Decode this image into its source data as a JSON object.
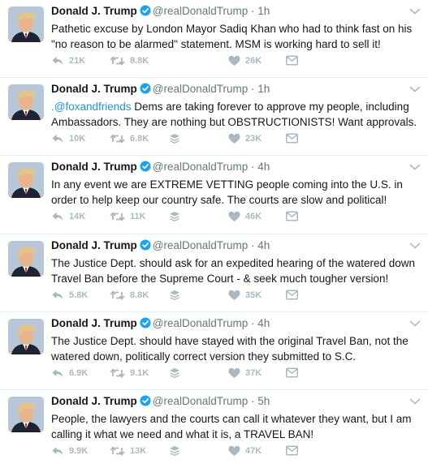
{
  "tweets": [
    {
      "name": "Donald J. Trump",
      "handle": "@realDonaldTrump",
      "dot": "·",
      "time": "1h",
      "mention": "",
      "text": "Pathetic excuse by London Mayor Sadiq Khan who had to think fast on his \"no reason to be alarmed\" statement. MSM is working hard to sell it!",
      "replies": "21K",
      "retweets": "8.8K",
      "likes": "26K",
      "icon_after_retweet": "heart-icon"
    },
    {
      "name": "Donald J. Trump",
      "handle": "@realDonaldTrump",
      "dot": "·",
      "time": "1h",
      "mention": ".@foxandfriends",
      "text": "  Dems are taking forever to approve my people, including Ambassadors. They are nothing but OBSTRUCTIONISTS! Want approvals.",
      "replies": "10K",
      "retweets": "6.8K",
      "likes": "23K",
      "icon_after_retweet": "buffer-icon"
    },
    {
      "name": "Donald J. Trump",
      "handle": "@realDonaldTrump",
      "dot": "·",
      "time": "4h",
      "mention": "",
      "text": "In any event we are EXTREME VETTING people coming into the U.S. in order to help keep our country safe. The courts are slow and political!",
      "replies": "14K",
      "retweets": "11K",
      "likes": "46K",
      "icon_after_retweet": "buffer-icon"
    },
    {
      "name": "Donald J. Trump",
      "handle": "@realDonaldTrump",
      "dot": "·",
      "time": "4h",
      "mention": "",
      "text": "The Justice Dept. should ask for an expedited hearing of the watered down Travel Ban before the Supreme Court - & seek much tougher version!",
      "replies": "5.8K",
      "retweets": "8.8K",
      "likes": "35K",
      "icon_after_retweet": "buffer-icon"
    },
    {
      "name": "Donald J. Trump",
      "handle": "@realDonaldTrump",
      "dot": "·",
      "time": "4h",
      "mention": "",
      "text": "The Justice Dept. should have stayed with the original Travel Ban, not the watered down, politically correct version they submitted to S.C.",
      "replies": "6.9K",
      "retweets": "9.1K",
      "likes": "37K",
      "icon_after_retweet": "buffer-icon"
    },
    {
      "name": "Donald J. Trump",
      "handle": "@realDonaldTrump",
      "dot": "·",
      "time": "5h",
      "mention": "",
      "text": "People, the lawyers and the courts can call it whatever they want, but I am calling it what we need and what it is, a TRAVEL BAN!",
      "replies": "9.9K",
      "retweets": "13K",
      "likes": "47K",
      "icon_after_retweet": "buffer-icon"
    }
  ],
  "colors": {
    "text": "#14171a",
    "muted": "#657786",
    "icon": "#aab8c2",
    "link": "#1b95e0",
    "verified": "#1da1f2",
    "divider": "#e6ecf0"
  }
}
